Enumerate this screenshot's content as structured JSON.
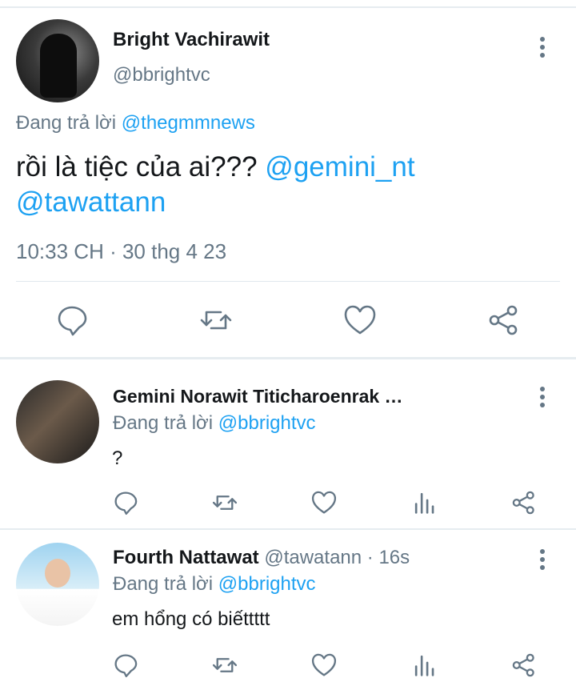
{
  "main_tweet": {
    "display_name": "Bright Vachirawit",
    "handle": "@bbrightvc",
    "replying_prefix": "Đang trả lời",
    "replying_to": "@thegmmnews",
    "text_plain": "rồi là tiệc của ai??? ",
    "text_mention_1": "@gemini_nt",
    "text_mention_2": "@tawattann",
    "timestamp": "10:33 CH · 30 thg 4 23",
    "actions": [
      "reply-icon",
      "retweet-icon",
      "like-icon",
      "share-icon"
    ]
  },
  "replies": [
    {
      "display_name": "Gemini Norawit Titicharoenrak …",
      "handle": "",
      "time": "",
      "replying_prefix": "Đang trả lời",
      "replying_to": "@bbrightvc",
      "text": "?",
      "actions": [
        "reply-icon",
        "retweet-icon",
        "like-icon",
        "analytics-icon",
        "share-icon"
      ]
    },
    {
      "display_name": "Fourth Nattawat",
      "handle": "@tawatann",
      "time": "· 16s",
      "replying_prefix": "Đang trả lời",
      "replying_to": "@bbrightvc",
      "text": "em hổng có biếttttt",
      "actions": [
        "reply-icon",
        "retweet-icon",
        "like-icon",
        "analytics-icon",
        "share-icon"
      ]
    }
  ],
  "colors": {
    "accent": "#1da1f2",
    "secondary_text": "#657786",
    "primary_text": "#14171a",
    "divider": "#e6ecf0"
  }
}
